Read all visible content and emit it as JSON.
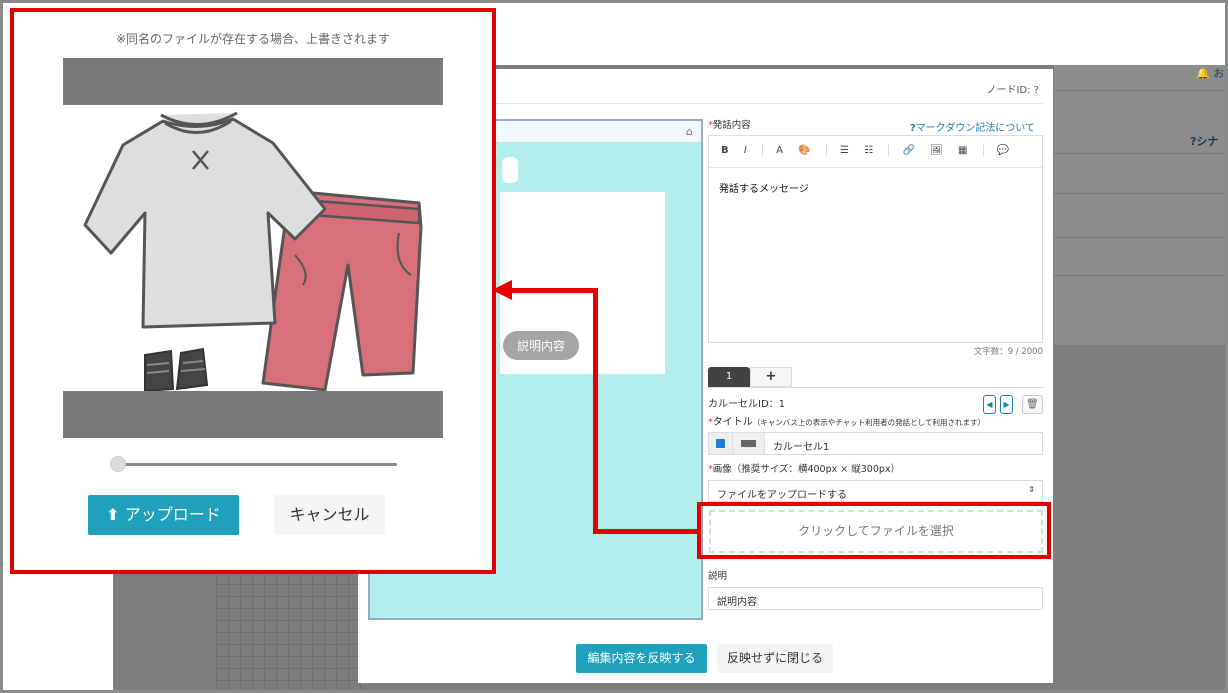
{
  "background": {
    "right_icon_1_glyph": "🔔 お",
    "right_icon_2_glyph": "?シナ"
  },
  "editor_modal": {
    "node_id": "ノードID: ?",
    "speech_label": "発話内容",
    "markdown_link": "マークダウン記法について",
    "toolbar_icons": [
      "bold-icon",
      "italic-icon",
      "font-color-icon",
      "palette-icon",
      "bullet-list-icon",
      "numbered-list-icon",
      "link-icon",
      "image-icon",
      "table-icon",
      "comment-icon"
    ],
    "toolbar_glyphs": [
      "B",
      "I",
      "A",
      "🎨",
      "☰",
      "☷",
      "🔗",
      "🖼",
      "▦",
      "💬"
    ],
    "editor_content": "発話するメッセージ",
    "char_count": "文字数：9 / 2000",
    "tabs": [
      "1",
      "+"
    ],
    "carousel_id": "カルーセルID：1",
    "title_label": "タイトル",
    "title_hint": "（キャンバス上の表示やチャット利用者の発話として利用されます）",
    "title_value": "カルーセル1",
    "image_label": "画像（推奨サイズ：横400px × 縦300px）",
    "upload_select_value": "ファイルをアップロードする",
    "dropzone_text": "クリックしてファイルを選択",
    "description_label": "説明",
    "description_value": "説明内容",
    "apply_button": "編集内容を反映する",
    "close_button": "反映せずに閉じる",
    "preview_pill": "説明内容",
    "colors": {
      "accent": "#1fa1bb",
      "preview_bg": "#b3eeed",
      "highlight": "#e50000"
    }
  },
  "upload_popup": {
    "notice": "※同名のファイルが存在する場合、上書きされます",
    "zoom_level": 0,
    "upload_button": "アップロード",
    "cancel_button": "キャンセル"
  }
}
